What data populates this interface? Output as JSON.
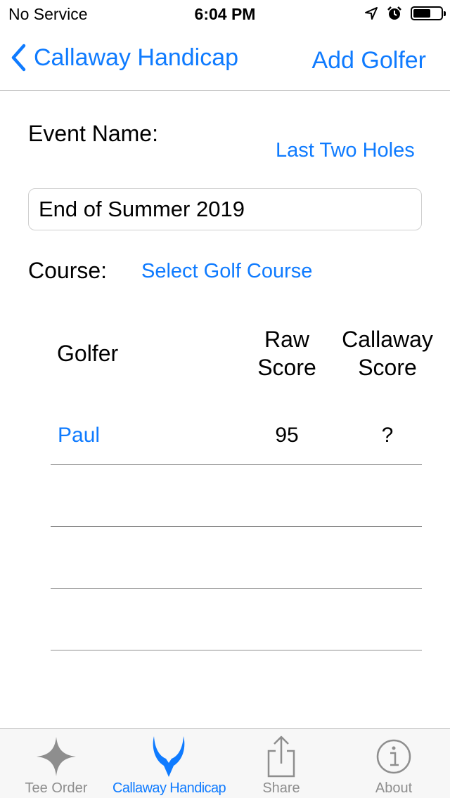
{
  "status_bar": {
    "carrier": "No Service",
    "time": "6:04 PM"
  },
  "nav": {
    "back_label": "Callaway Handicap",
    "right_label": "Add Golfer"
  },
  "form": {
    "event_name_label": "Event Name:",
    "last_two_holes_label": "Last Two Holes",
    "event_name_value": "End of Summer 2019",
    "course_label": "Course:",
    "select_course_label": "Select Golf Course"
  },
  "table": {
    "headers": {
      "golfer": "Golfer",
      "raw_score_line1": "Raw",
      "raw_score_line2": "Score",
      "callaway_score_line1": "Callaway",
      "callaway_score_line2": "Score"
    },
    "rows": [
      {
        "golfer": "Paul",
        "raw_score": "95",
        "callaway_score": "?"
      }
    ]
  },
  "tab_bar": {
    "tabs": [
      {
        "label": "Tee Order",
        "icon": "star-icon"
      },
      {
        "label": "Callaway Handicap",
        "icon": "horns-icon"
      },
      {
        "label": "Share",
        "icon": "share-icon"
      },
      {
        "label": "About",
        "icon": "info-icon"
      }
    ],
    "active_index": 1
  },
  "colors": {
    "accent": "#0f7bff",
    "inactive": "#8e8e8e"
  }
}
